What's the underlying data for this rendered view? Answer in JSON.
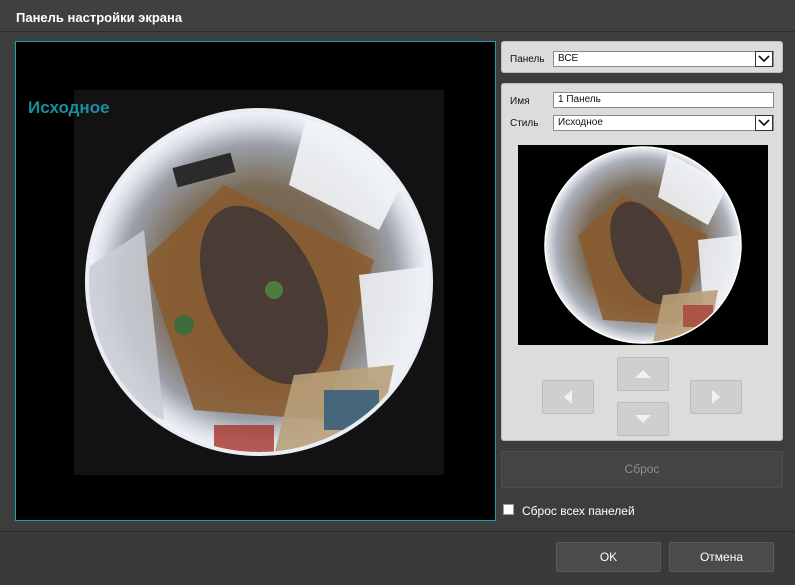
{
  "window": {
    "title": "Панель настройки экрана"
  },
  "viewport": {
    "label": "Исходное"
  },
  "panel_select": {
    "label": "Панель",
    "value": "ВСЕ"
  },
  "settings": {
    "name_label": "Имя",
    "name_value": "1 Панель",
    "style_label": "Стиль",
    "style_value": "Исходное"
  },
  "nav": {
    "left_icon": "arrow-left-icon",
    "up_icon": "arrow-up-icon",
    "down_icon": "arrow-down-icon",
    "right_icon": "arrow-right-icon"
  },
  "reset_label": "Сброс",
  "reset_all": {
    "label": "Сброс всех панелей",
    "checked": false
  },
  "footer": {
    "ok_label": "OK",
    "cancel_label": "Отмена"
  },
  "colors": {
    "accent": "#1aa0b4",
    "label_teal": "#1a8e9f",
    "bg": "#3d3d3d"
  }
}
